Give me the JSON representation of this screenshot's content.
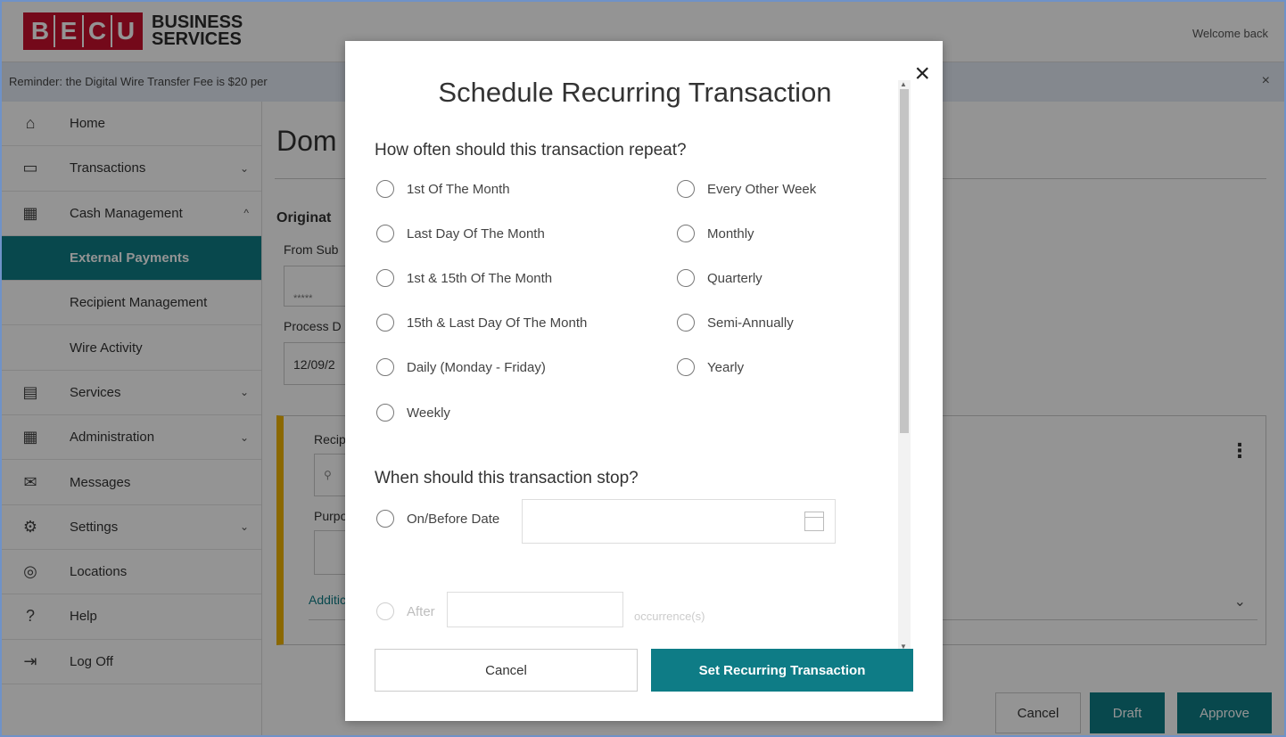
{
  "header": {
    "logo_letters": [
      "B",
      "E",
      "C",
      "U"
    ],
    "logo_line1": "BUSINESS",
    "logo_line2": "SERVICES",
    "welcome": "Welcome back"
  },
  "banner": {
    "text": "Reminder: the Digital Wire Transfer Fee is $20 per",
    "close": "×"
  },
  "sidebar": {
    "items": [
      {
        "label": "Home",
        "icon": "home-icon",
        "chevron": ""
      },
      {
        "label": "Transactions",
        "icon": "card-icon",
        "chevron": "⌄"
      },
      {
        "label": "Cash Management",
        "icon": "building-icon",
        "chevron": "^"
      },
      {
        "label": "External Payments",
        "icon": "",
        "chevron": "",
        "active": true
      },
      {
        "label": "Recipient Management",
        "icon": "",
        "chevron": ""
      },
      {
        "label": "Wire Activity",
        "icon": "",
        "chevron": ""
      },
      {
        "label": "Services",
        "icon": "calculator-icon",
        "chevron": "⌄"
      },
      {
        "label": "Administration",
        "icon": "building-icon",
        "chevron": "⌄"
      },
      {
        "label": "Messages",
        "icon": "envelope-icon",
        "chevron": ""
      },
      {
        "label": "Settings",
        "icon": "gear-icon",
        "chevron": "⌄"
      },
      {
        "label": "Locations",
        "icon": "location-icon",
        "chevron": ""
      },
      {
        "label": "Help",
        "icon": "help-icon",
        "chevron": ""
      },
      {
        "label": "Log Off",
        "icon": "logout-icon",
        "chevron": ""
      }
    ]
  },
  "main": {
    "title": "Dom",
    "originator": "Originat",
    "from_sub": "From Sub",
    "from_value": "*****",
    "process_date": "Process D",
    "process_value": "12/09/2",
    "recipient": "Recip",
    "search_placeholder": "",
    "purpose": "Purpo",
    "additional": "Additic"
  },
  "footer": {
    "cancel": "Cancel",
    "draft": "Draft",
    "approve": "Approve"
  },
  "modal": {
    "title": "Schedule Recurring Transaction",
    "close": "×",
    "repeat_question": "How often should this transaction repeat?",
    "repeat_options_left": [
      "1st Of The Month",
      "Last Day Of The Month",
      "1st & 15th Of The Month",
      "15th & Last Day Of The Month",
      "Daily (Monday - Friday)",
      "Weekly"
    ],
    "repeat_options_right": [
      "Every Other Week",
      "Monthly",
      "Quarterly",
      "Semi-Annually",
      "Yearly"
    ],
    "stop_question": "When should this transaction stop?",
    "stop_on_date": "On/Before Date",
    "stop_after": "After",
    "occurrences": "occurrence(s)",
    "cancel": "Cancel",
    "set": "Set Recurring Transaction"
  },
  "colors": {
    "brand_red": "#c8102e",
    "teal": "#0e7c86",
    "accent_yellow": "#f0b400"
  }
}
